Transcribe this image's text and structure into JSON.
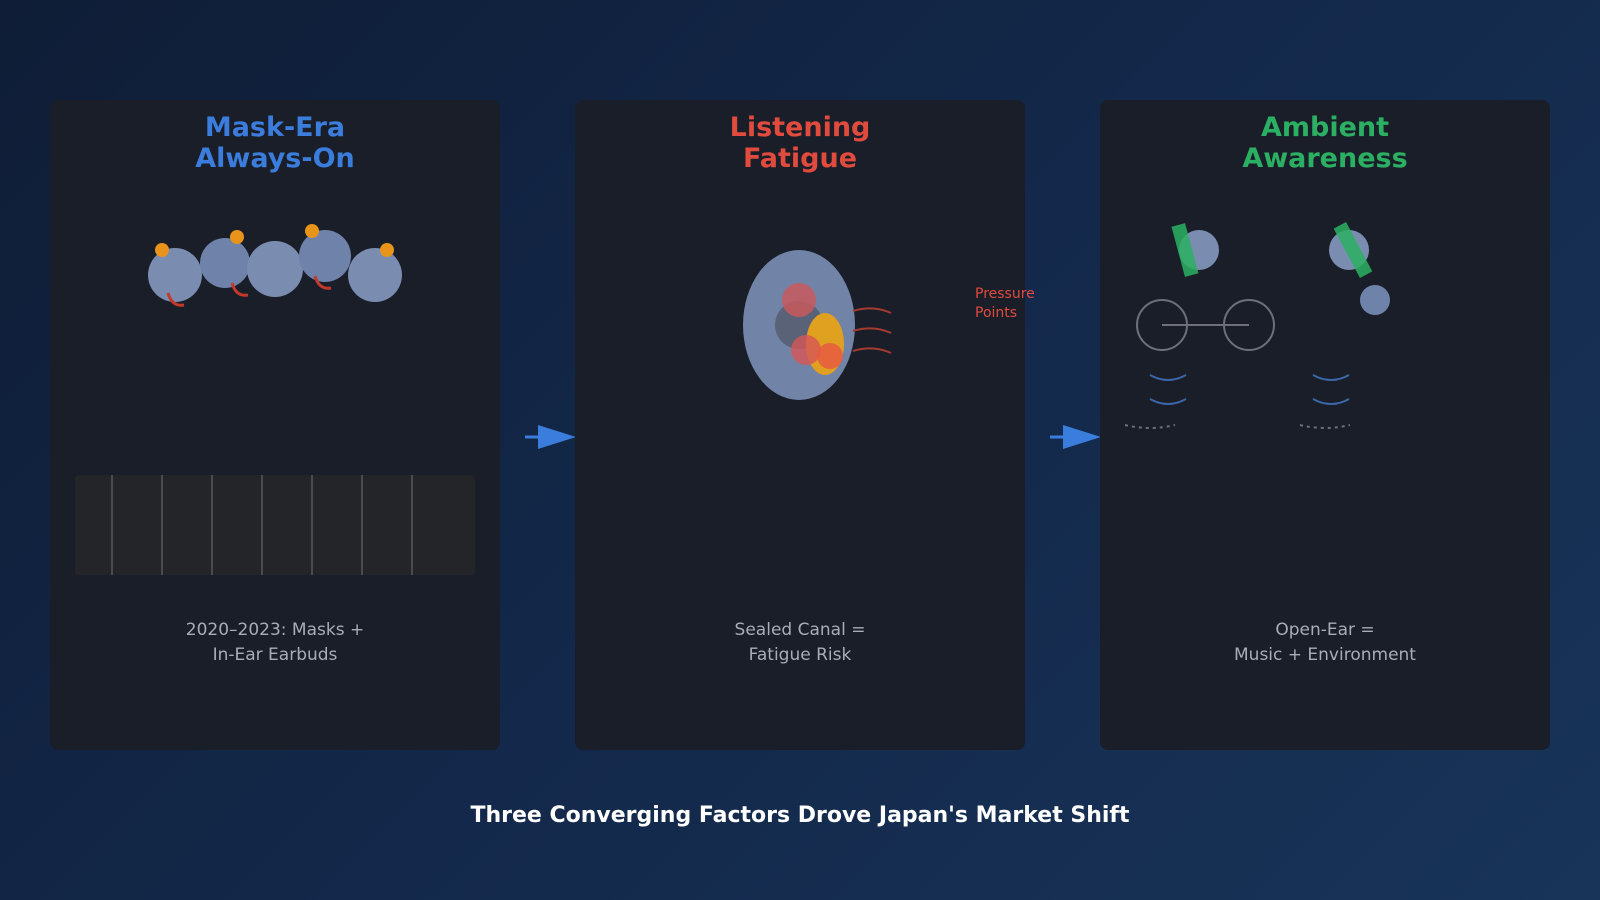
{
  "panels": [
    {
      "title": "Mask-Era\nAlways-On",
      "caption": "2020–2023: Masks +\nIn-Ear Earbuds",
      "title_color": "#3b7ddd",
      "icon": "commuter-crowd-with-earbuds"
    },
    {
      "title": "Listening\nFatigue",
      "caption": "Sealed Canal =\nFatigue Risk",
      "annotation": "Pressure\nPoints",
      "title_color": "#e04b3e",
      "icon": "ear-pressure-points"
    },
    {
      "title": "Ambient\nAwareness",
      "caption": "Open-Ear =\nMusic + Environment",
      "title_color": "#2bb063",
      "icon": "open-ear-listeners"
    }
  ],
  "arrows": [
    "right-arrow",
    "right-arrow"
  ],
  "footer": {
    "title": "Three Converging Factors Drove Japan's Market Shift"
  },
  "colors": {
    "background": "#13284a",
    "panel": "#191e28",
    "blue": "#3b7ddd",
    "red": "#e04b3e",
    "green": "#2bb063",
    "earbud": "#e8941a"
  }
}
